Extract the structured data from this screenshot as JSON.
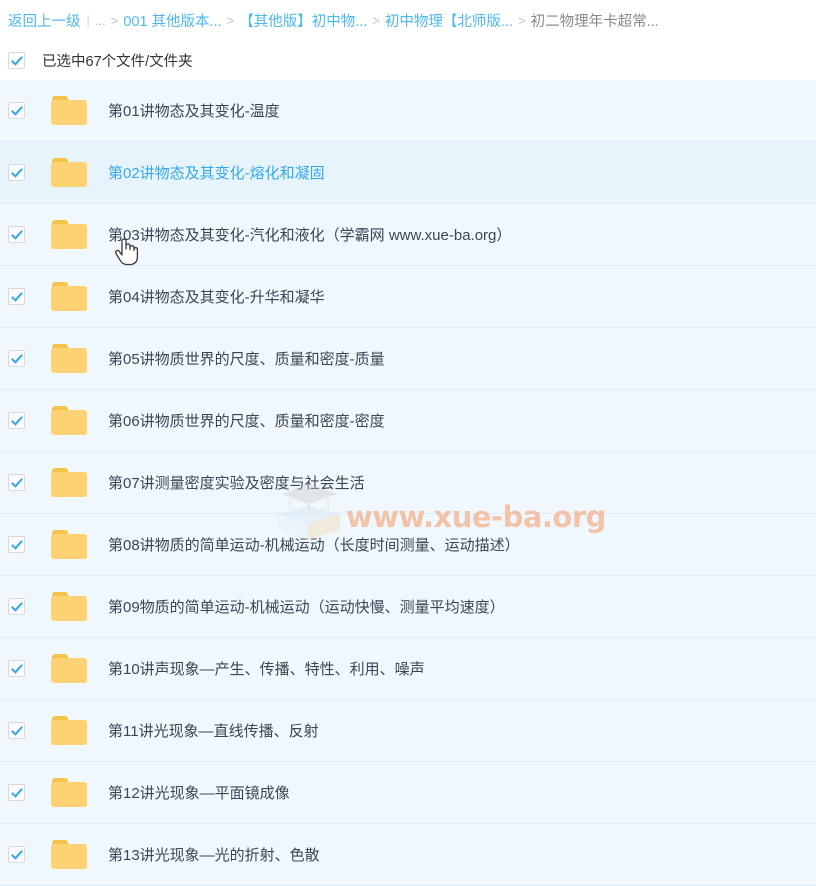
{
  "breadcrumb": {
    "back_label": "返回上一级",
    "separator": ">",
    "pipe": "|",
    "ellipsis": "...",
    "items": [
      {
        "label": "001 其他版本...",
        "current": false
      },
      {
        "label": "【其他版】初中物...",
        "current": false
      },
      {
        "label": "初中物理【北师版...",
        "current": false
      },
      {
        "label": "初二物理年卡超常...",
        "current": true
      }
    ]
  },
  "selection": {
    "label": "已选中67个文件/文件夹",
    "count": 67,
    "checked": true
  },
  "files": [
    {
      "name": "第01讲物态及其变化-温度",
      "checked": true,
      "hover": false
    },
    {
      "name": "第02讲物态及其变化-熔化和凝固",
      "checked": true,
      "hover": true
    },
    {
      "name": "第03讲物态及其变化-汽化和液化（学霸网 www.xue-ba.org）",
      "checked": true,
      "hover": false
    },
    {
      "name": "第04讲物态及其变化-升华和凝华",
      "checked": true,
      "hover": false
    },
    {
      "name": "第05讲物质世界的尺度、质量和密度-质量",
      "checked": true,
      "hover": false
    },
    {
      "name": "第06讲物质世界的尺度、质量和密度-密度",
      "checked": true,
      "hover": false
    },
    {
      "name": "第07讲测量密度实验及密度与社会生活",
      "checked": true,
      "hover": false
    },
    {
      "name": "第08讲物质的简单运动-机械运动（长度时间测量、运动描述）",
      "checked": true,
      "hover": false
    },
    {
      "name": "第09物质的简单运动-机械运动（运动快慢、测量平均速度）",
      "checked": true,
      "hover": false
    },
    {
      "name": "第10讲声现象—产生、传播、特性、利用、噪声",
      "checked": true,
      "hover": false
    },
    {
      "name": "第11讲光现象—直线传播、反射",
      "checked": true,
      "hover": false
    },
    {
      "name": "第12讲光现象—平面镜成像",
      "checked": true,
      "hover": false
    },
    {
      "name": "第13讲光现象—光的折射、色散",
      "checked": true,
      "hover": false
    }
  ],
  "watermark": {
    "text": "www.xue-ba.org",
    "logo_name": "graduation-cap-book-logo",
    "color": "#f5b08a"
  },
  "cursor": {
    "type": "pointer-hand"
  },
  "colors": {
    "link": "#4cb8f0",
    "row_bg": "#f0f8fd",
    "row_hover_bg": "#e8f4fc",
    "folder": "#fdd272",
    "folder_tab": "#f5c349",
    "checkbox_check": "#2fa8e8",
    "text": "#3d4454"
  }
}
